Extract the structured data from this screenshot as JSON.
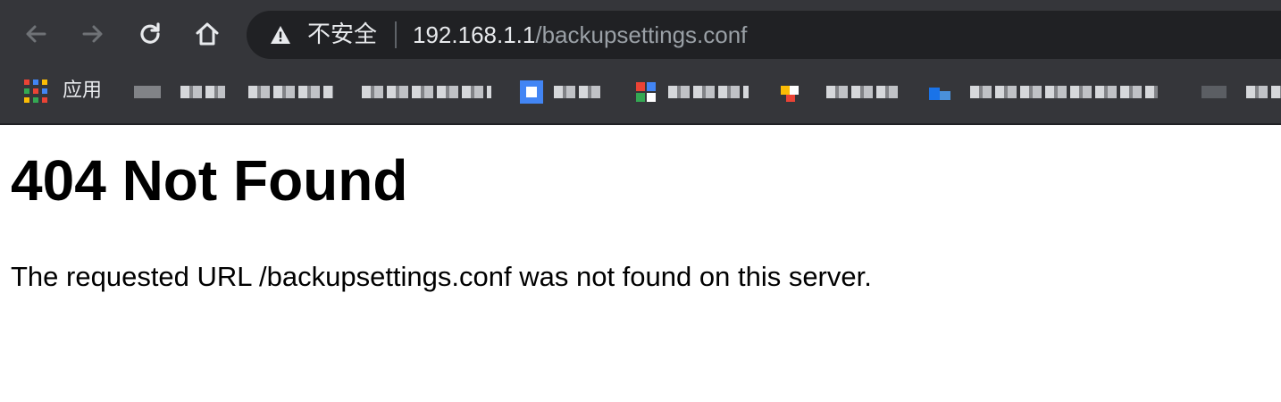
{
  "browser": {
    "toolbar": {
      "back_icon": "arrow-left-icon",
      "forward_icon": "arrow-right-icon",
      "reload_icon": "reload-icon",
      "home_icon": "home-icon"
    },
    "omnibox": {
      "security_icon": "warning-triangle-icon",
      "security_label": "不安全",
      "url_host": "192.168.1.1",
      "url_path": "/backupsettings.conf"
    },
    "bookmarks": {
      "apps_label": "应用",
      "items_note": [
        "",
        "",
        "",
        "",
        "",
        "",
        "",
        ""
      ]
    },
    "colors": {
      "toolbar_bg": "#35363a",
      "omnibox_bg": "#202124",
      "text_primary": "#e8eaed",
      "text_muted": "#9aa0a6"
    }
  },
  "page": {
    "heading": "404 Not Found",
    "message": "The requested URL /backupsettings.conf was not found on this server."
  }
}
